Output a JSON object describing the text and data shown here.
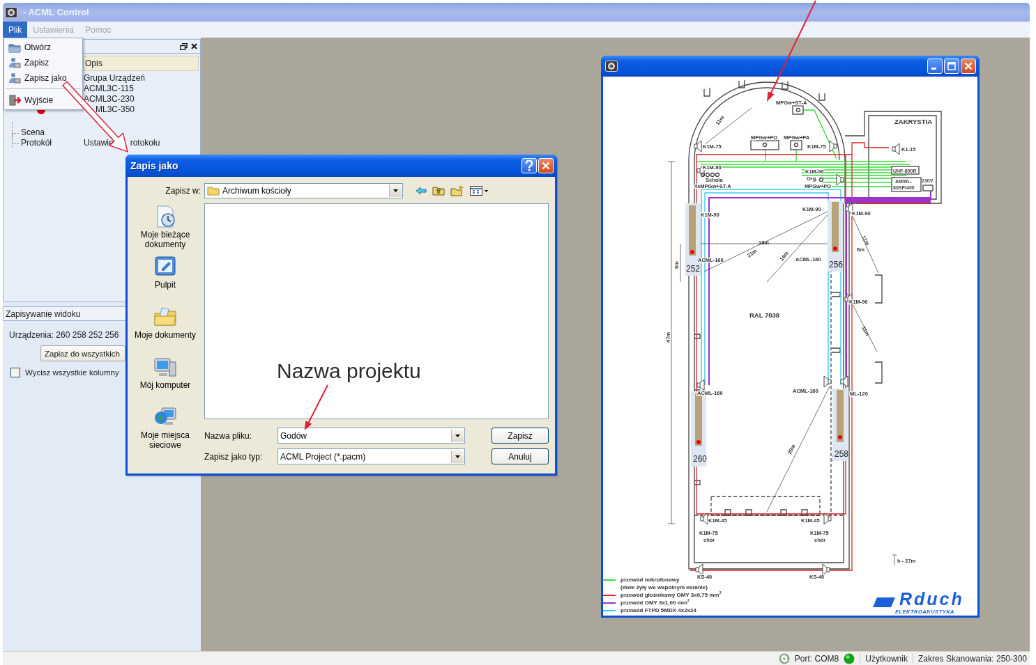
{
  "window": {
    "title": "- ACML Control"
  },
  "menu_bar": [
    {
      "label": "Plik",
      "selected": true,
      "disabled": false
    },
    {
      "label": "Ustawienia",
      "selected": false,
      "disabled": true
    },
    {
      "label": "Pomoc",
      "selected": false,
      "disabled": true
    }
  ],
  "file_menu": [
    {
      "kind": "item",
      "label": "Otwórz"
    },
    {
      "kind": "item",
      "label": "Zapisz"
    },
    {
      "kind": "item",
      "label": "Zapisz jako"
    },
    {
      "kind": "separator"
    },
    {
      "kind": "item",
      "label": "Wyjście"
    }
  ],
  "device_tree": {
    "columns": [
      "Opis"
    ],
    "rows": [
      {
        "description": "Grupa Urządzeń"
      },
      {
        "description": "ACML3C-115"
      },
      {
        "description": "ACML3C-230"
      },
      {
        "description": "ML3C-350",
        "color": "#e60000"
      },
      {
        "name": "Scena"
      },
      {
        "name": "Protokół",
        "description_parts": [
          "Ustawie",
          "rotokołu"
        ]
      }
    ]
  },
  "view_panel": {
    "title": "Zapisywanie widoku",
    "devices": "Urządzenia: 260 258 252 256",
    "apply_button": "Zapisz do wszystkich",
    "mute_all": {
      "label": "Wycisz wszystkie kolumny",
      "checked": false
    }
  },
  "save_dialog": {
    "title": "Zapis jako",
    "save_in_label": "Zapisz w:",
    "save_in": "Archiwum kościoły",
    "places": [
      "Moje bieżące dokumenty",
      "Pulpit",
      "Moje dokumenty",
      "Mój komputer",
      "Moje miejsca sieciowe"
    ],
    "file_name_label": "Nazwa pliku:",
    "file_name": "Godów",
    "file_type_label": "Zapisz jako typ:",
    "file_type": "ACML Project (*.pacm)",
    "buttons": [
      "Zapisz",
      "Anuluj"
    ]
  },
  "plan_window": {
    "labels": [
      {
        "text": "MPGw+ST-A",
        "kind": "label"
      },
      {
        "text": "MPGw+PO",
        "kind": "label"
      },
      {
        "text": "MPGw+PA",
        "kind": "label"
      },
      {
        "text": "K1M-75",
        "kind": "label"
      },
      {
        "text": "K1M-75",
        "kind": "label"
      },
      {
        "text": "ZAKRYSTIA",
        "kind": "title"
      },
      {
        "text": "K1-15",
        "kind": "label"
      },
      {
        "text": "K1M-90",
        "kind": "label"
      },
      {
        "text": "Schola",
        "kind": "label"
      },
      {
        "text": "4xMPGw+ST-A",
        "kind": "label"
      },
      {
        "text": "K1M-90",
        "kind": "label"
      },
      {
        "text": "Org.",
        "kind": "label"
      },
      {
        "text": "MPGw+PO",
        "kind": "label"
      },
      {
        "text": "UHF-800R",
        "kind": "small"
      },
      {
        "text": "AMWL-",
        "kind": "small"
      },
      {
        "text": "80SP/400",
        "kind": "small"
      },
      {
        "text": "230V",
        "kind": "small"
      },
      {
        "text": "K1M-90",
        "kind": "label"
      },
      {
        "text": "K1M-90",
        "kind": "label"
      },
      {
        "text": "K1M-90",
        "kind": "label"
      },
      {
        "text": "11m",
        "kind": "dimension"
      },
      {
        "text": "18m",
        "kind": "dimension"
      },
      {
        "text": "21m",
        "kind": "dimension"
      },
      {
        "text": "16m",
        "kind": "dimension"
      },
      {
        "text": "6m",
        "kind": "dimension"
      },
      {
        "text": "11m",
        "kind": "dimension"
      },
      {
        "text": "ACML-160",
        "kind": "label"
      },
      {
        "text": "ACML-160",
        "kind": "label"
      },
      {
        "text": "252",
        "kind": "device"
      },
      {
        "text": "256",
        "kind": "device"
      },
      {
        "text": "6m",
        "kind": "dimension"
      },
      {
        "text": "47m",
        "kind": "dimension"
      },
      {
        "text": "RAL 7038",
        "kind": "title"
      },
      {
        "text": "K1M-90",
        "kind": "label"
      },
      {
        "text": "11m",
        "kind": "dimension"
      },
      {
        "text": "ACML-160",
        "kind": "label"
      },
      {
        "text": "ACML-160",
        "kind": "label"
      },
      {
        "text": "ML-120",
        "kind": "label"
      },
      {
        "text": "260",
        "kind": "device"
      },
      {
        "text": "258",
        "kind": "device"
      },
      {
        "text": "20m",
        "kind": "dimension"
      },
      {
        "text": "K1M-45",
        "kind": "label"
      },
      {
        "text": "K1M-45",
        "kind": "label"
      },
      {
        "text": "K1M-75",
        "kind": "label"
      },
      {
        "text": "chór",
        "kind": "label"
      },
      {
        "text": "K1M-75",
        "kind": "label"
      },
      {
        "text": "chór",
        "kind": "label"
      },
      {
        "text": "h - 27m",
        "kind": "label"
      },
      {
        "text": "KS-40",
        "kind": "label"
      },
      {
        "text": "KS-40",
        "kind": "label"
      }
    ],
    "legend": [
      {
        "label": "przewód mikrofonowy",
        "note": "(dwie żyły we wspólnym ekranie)",
        "color": "#33dd33"
      },
      {
        "label": "przewód głośnikowy OMY 3x0,75 mm$^{2}$",
        "color": "#dd2222"
      },
      {
        "label": "przewód OMY 3x1,00 mm$^{2}$",
        "color": "#9933cc"
      },
      {
        "label": "przewód FTPD 5MDX 4x2x24",
        "color": "#33ccee"
      }
    ],
    "logo": {
      "name": "Rduch",
      "tagline": "ELEKTROAKUSTYKA"
    }
  },
  "annotations": [
    {
      "text": "Nazwa projektu"
    }
  ],
  "status_bar": {
    "port": "Port: COM8",
    "user": "Użytkownik",
    "scan_range": "Zakres Skanowania: 250-300"
  }
}
